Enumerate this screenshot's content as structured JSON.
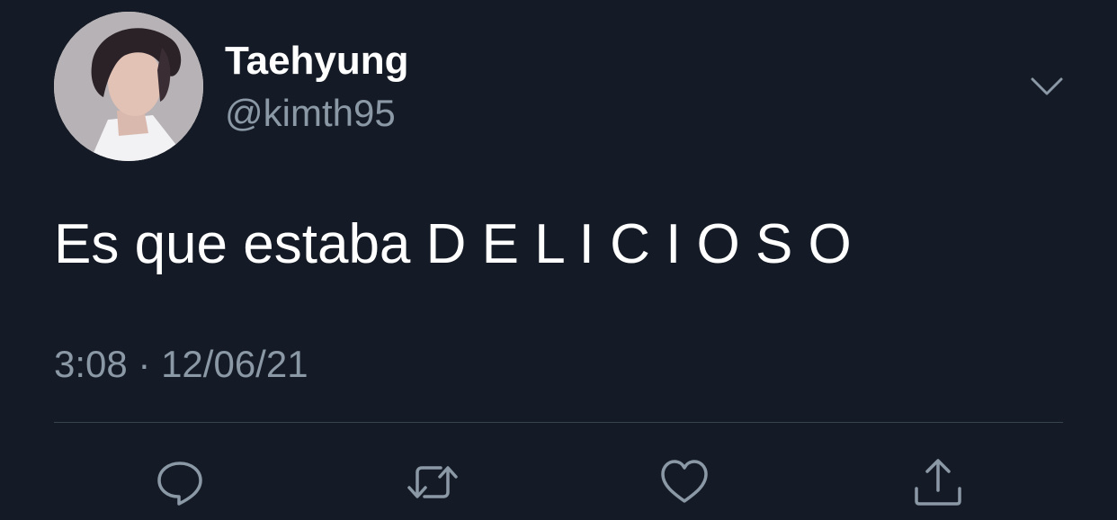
{
  "tweet": {
    "display_name": "Taehyung",
    "handle": "@kimth95",
    "text": "Es que estaba D E L I C I O S O",
    "timestamp": "3:08 · 12/06/21"
  },
  "icons": {
    "avatar": "avatar",
    "menu": "chevron-down-icon",
    "reply": "reply-icon",
    "retweet": "retweet-icon",
    "like": "heart-icon",
    "share": "share-icon"
  },
  "colors": {
    "background": "#151b26",
    "primary_text": "#ffffff",
    "secondary_text": "#8b98a5",
    "divider": "#38444d"
  }
}
